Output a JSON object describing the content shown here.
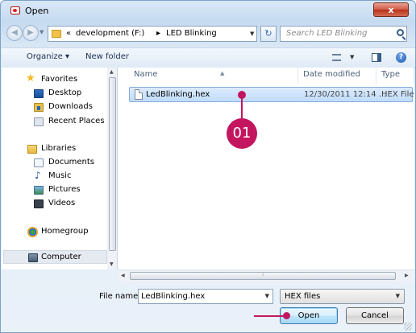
{
  "window": {
    "title": "Open",
    "close_label": "x"
  },
  "address": {
    "root_chevron": "«",
    "crumbs": [
      "development (F:)",
      "LED Blinking"
    ],
    "separator": "▸",
    "search_placeholder": "Search LED Blinking"
  },
  "toolbar": {
    "organize_label": "Organize ▾",
    "new_folder_label": "New folder",
    "help_label": "?"
  },
  "nav": {
    "favorites": "Favorites",
    "favorites_items": [
      "Desktop",
      "Downloads",
      "Recent Places"
    ],
    "libraries": "Libraries",
    "libraries_items": [
      "Documents",
      "Music",
      "Pictures",
      "Videos"
    ],
    "homegroup": "Homegroup",
    "computer": "Computer"
  },
  "columns": {
    "name": "Name",
    "date_modified": "Date modified",
    "type": "Type"
  },
  "files": [
    {
      "name": "LedBlinking.hex",
      "date": "12/30/2011 12:14 ...",
      "type": "HEX File"
    }
  ],
  "callout": {
    "number": "01",
    "color": "#c4155f"
  },
  "bottom": {
    "file_name_label": "File name:",
    "file_name_value": "LedBlinking.hex",
    "file_type": "HEX files",
    "open_label": "Open",
    "cancel_label": "Cancel"
  }
}
